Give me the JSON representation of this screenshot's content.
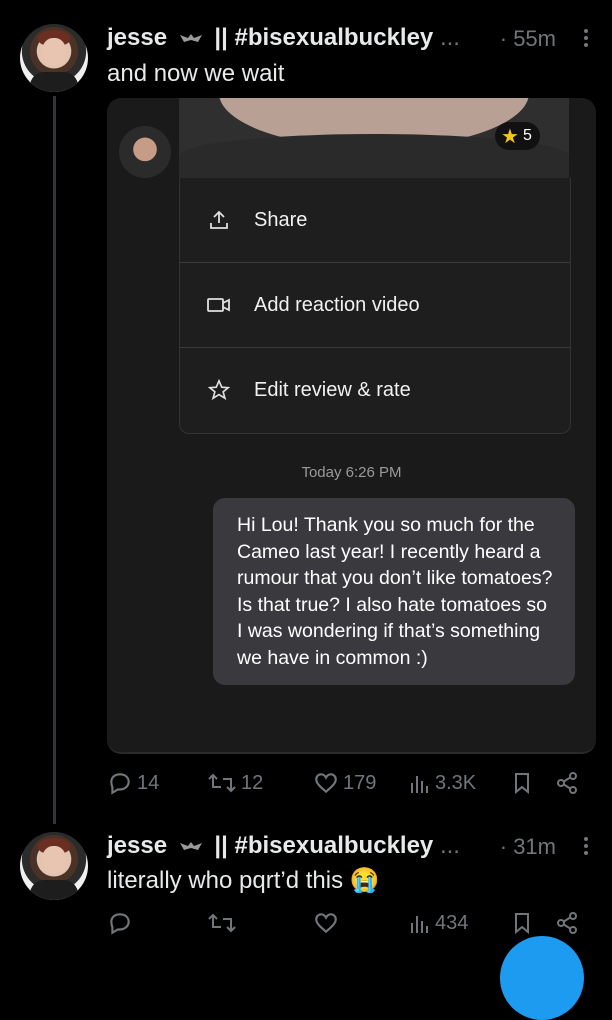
{
  "post1": {
    "author": "jesse",
    "handle_tail": "|| #bisexualbuckley",
    "ellipsis": "...",
    "time": "· 55m",
    "text": "and now we wait",
    "media": {
      "star_count": "5",
      "menu": [
        {
          "icon": "share-icon",
          "label": "Share"
        },
        {
          "icon": "video-icon",
          "label": "Add reaction video"
        },
        {
          "icon": "star-icon",
          "label": "Edit review & rate"
        }
      ],
      "timestamp": "Today 6:26 PM",
      "message": "Hi Lou! Thank you so much for the Cameo last year! I recently heard a rumour that you don’t like tomatoes? Is that true? I also hate tomatoes so I was wondering if that’s something we have in common :)"
    },
    "actions": {
      "replies": "14",
      "reposts": "12",
      "likes": "179",
      "views": "3.3K"
    }
  },
  "post2": {
    "author": "jesse",
    "handle_tail": "|| #bisexualbuckley",
    "ellipsis": "...",
    "time": "· 31m",
    "text": "literally who pqrt’d this",
    "emoji": "😭",
    "actions": {
      "views": "434"
    }
  }
}
